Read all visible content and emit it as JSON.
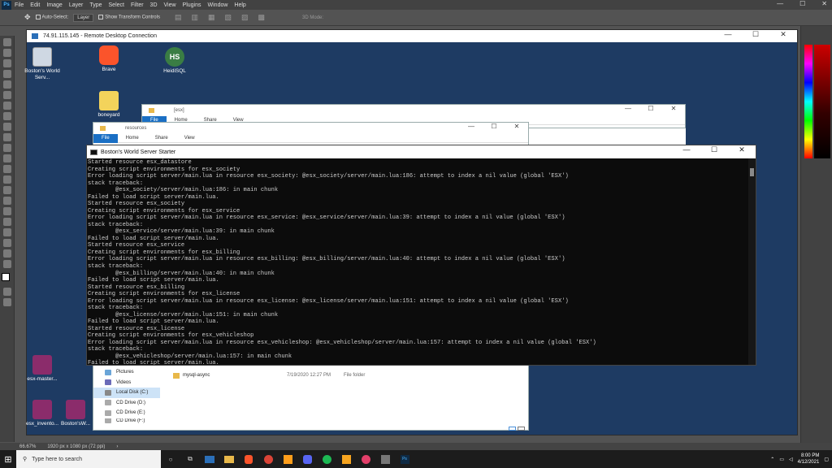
{
  "photoshop": {
    "logo": "Ps",
    "menu": [
      "File",
      "Edit",
      "Image",
      "Layer",
      "Type",
      "Select",
      "Filter",
      "3D",
      "View",
      "Plugins",
      "Window",
      "Help"
    ],
    "options": {
      "auto_select_label": "Auto-Select:",
      "auto_select_value": "Layer",
      "show_transform_label": "Show Transform Controls",
      "mode_3d": "3D Mode:"
    },
    "status": {
      "zoom": "66.67%",
      "doc_size": "1920 px x 1080 px (72 ppi)"
    }
  },
  "rdp": {
    "title": "74.91.115.145 - Remote Desktop Connection"
  },
  "desktop_icons": [
    {
      "label": "Boston's World Serv...",
      "color": "#cfd8e3"
    },
    {
      "label": "Brave",
      "color": "#fb542b"
    },
    {
      "label": "HeidiSQL",
      "color": "#3a7d44"
    },
    {
      "label": "boneyard",
      "color": "#f3d35b"
    },
    {
      "label": "esx-master...",
      "color": "#8b2c6b"
    },
    {
      "label": "esx_invento...",
      "color": "#8b2c6b"
    },
    {
      "label": "Boston'sW...",
      "color": "#8b2c6b"
    }
  ],
  "explorer_back": {
    "title": "[esx]",
    "tabs": [
      "File",
      "Home",
      "Share",
      "View"
    ]
  },
  "explorer_front": {
    "title": "resources",
    "tabs": [
      "File",
      "Home",
      "Share",
      "View"
    ],
    "nav": [
      "Pictures",
      "Videos",
      "Local Disk (C:)",
      "CD Drive (D:)",
      "CD Drive (E:)",
      "CD Drive (F:)"
    ],
    "file_name": "mysql-async",
    "file_date": "7/19/2020 12:27 PM",
    "file_type": "File folder"
  },
  "console": {
    "title": "Boston's World Server Starter",
    "lines": [
      "Started resource esx_datastore",
      "Creating script environments for esx_society",
      "Error loading script server/main.lua in resource esx_society: @esx_society/server/main.lua:186: attempt to index a nil value (global 'ESX')",
      "stack traceback:",
      "        @esx_society/server/main.lua:186: in main chunk",
      "Failed to load script server/main.lua.",
      "Started resource esx_society",
      "Creating script environments for esx_service",
      "Error loading script server/main.lua in resource esx_service: @esx_service/server/main.lua:39: attempt to index a nil value (global 'ESX')",
      "stack traceback:",
      "        @esx_service/server/main.lua:39: in main chunk",
      "Failed to load script server/main.lua.",
      "Started resource esx_service",
      "Creating script environments for esx_billing",
      "Error loading script server/main.lua in resource esx_billing: @esx_billing/server/main.lua:40: attempt to index a nil value (global 'ESX')",
      "stack traceback:",
      "        @esx_billing/server/main.lua:40: in main chunk",
      "Failed to load script server/main.lua.",
      "Started resource esx_billing",
      "Creating script environments for esx_license",
      "Error loading script server/main.lua in resource esx_license: @esx_license/server/main.lua:151: attempt to index a nil value (global 'ESX')",
      "stack traceback:",
      "        @esx_license/server/main.lua:151: in main chunk",
      "Failed to load script server/main.lua.",
      "Started resource esx_license",
      "Creating script environments for esx_vehicleshop",
      "Error loading script server/main.lua in resource esx_vehicleshop: @esx_vehicleshop/server/main.lua:157: attempt to index a nil value (global 'ESX')",
      "stack traceback:",
      "        @esx_vehicleshop/server/main.lua:157: in main chunk",
      "Failed to load script server/main.lua."
    ]
  },
  "taskbar": {
    "search_placeholder": "Type here to search",
    "time": "8:00 PM",
    "date": "4/12/2021"
  }
}
